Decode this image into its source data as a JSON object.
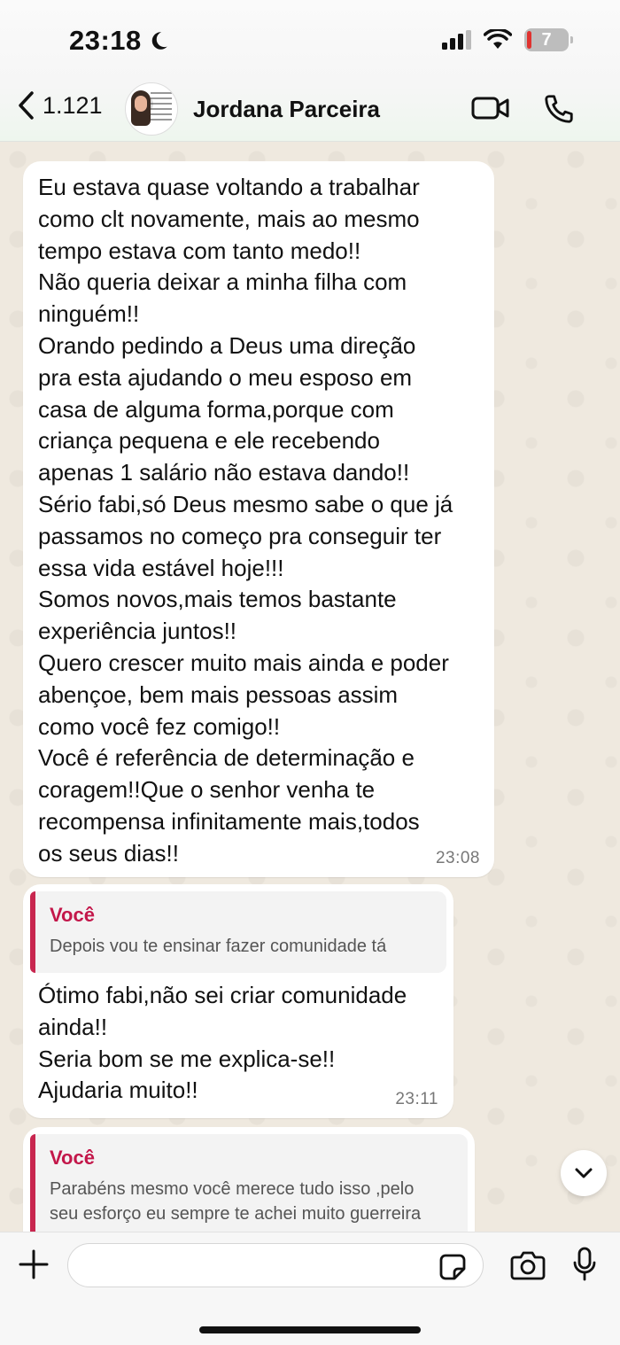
{
  "status_bar": {
    "time": "23:18",
    "battery": "7"
  },
  "header": {
    "back_count": "1.121",
    "contact_name": "Jordana Parceira"
  },
  "messages": [
    {
      "text": "Eu estava quase voltando a trabalhar\ncomo clt novamente, mais ao mesmo\ntempo estava com tanto medo!!\nNão queria deixar a minha filha com\nninguém!!\nOrando pedindo a Deus uma direção\npra esta ajudando o meu esposo em\ncasa de alguma forma,porque com\ncriança pequena e ele recebendo\napenas 1 salário não estava dando!!\nSério fabi,só Deus mesmo sabe o que já\npassamos no começo pra conseguir ter\nessa vida estável hoje!!!\nSomos novos,mais temos bastante\nexperiência juntos!!\nQuero crescer muito mais ainda e poder\nabençoe, bem mais pessoas assim\ncomo você fez comigo!!\nVocê é referência de determinação e\ncoragem!!Que o senhor venha te\nrecompensa infinitamente mais,todos\nos seus dias!!",
      "time": "23:08"
    },
    {
      "quote_author": "Você",
      "quote_text": "Depois vou te ensinar fazer comunidade tá",
      "text": "Ótimo fabi,não sei criar comunidade\nainda!!\nSeria bom se me explica-se!!\nAjudaria muito!!",
      "time": "23:11"
    },
    {
      "quote_author": "Você",
      "quote_text": "Parabéns mesmo você merece tudo isso ,pelo\nseu esforço eu sempre te achei muito guerreira"
    }
  ],
  "composer": {
    "value": "",
    "placeholder": ""
  },
  "colors": {
    "quote_accent": "#c8264f",
    "quote_author": "#c3174a",
    "chat_bg": "#efe9df"
  },
  "icons": [
    "moon-icon",
    "signal-icon",
    "wifi-icon",
    "battery-icon",
    "back-chevron-icon",
    "video-call-icon",
    "phone-icon",
    "chevron-down-icon",
    "plus-icon",
    "sticker-icon",
    "camera-icon",
    "microphone-icon"
  ]
}
